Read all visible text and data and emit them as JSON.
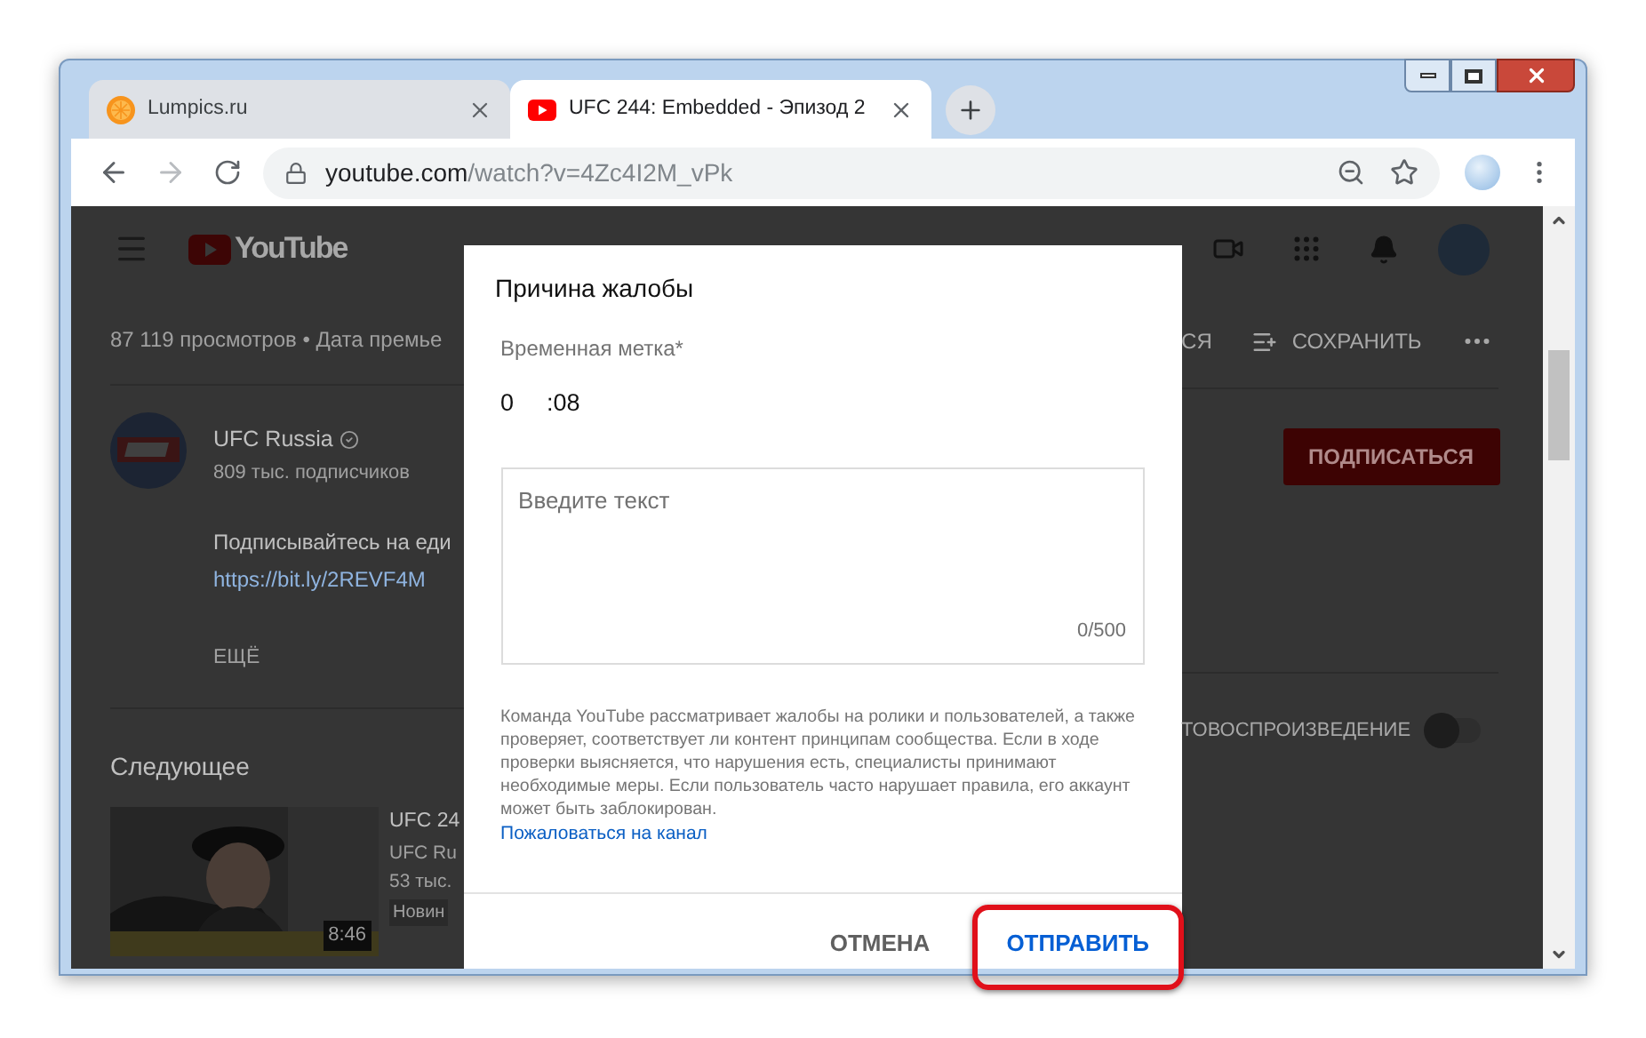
{
  "browser": {
    "tabs": [
      {
        "title": "Lumpics.ru",
        "kind": "fruit",
        "selected": false
      },
      {
        "title": "UFC 244: Embedded - Эпизод 2",
        "kind": "video",
        "selected": true
      }
    ],
    "address": {
      "host": "youtube.com",
      "path": "/watch?v=4Zc4I2M_vPk"
    }
  },
  "page": {
    "logo_text": "YouTube",
    "views_line": "87 119 просмотров • Дата премье",
    "partial_action": "СЯ",
    "save_label": "СОХРАНИТЬ",
    "channel": {
      "name": "UFC Russia",
      "subscribers": "809 тыс. подписчиков",
      "subscribe_button": "ПОДПИСАТЬСЯ",
      "description": "Подписывайтесь на еди",
      "link": "https://bit.ly/2REVF4M",
      "more": "ЕЩЁ"
    },
    "up_next": {
      "heading": "Следующее",
      "autoplay_label": "ТОВОСПРОИЗВЕДЕНИЕ",
      "autoplay_on": false,
      "items": [
        {
          "title": "UFC 24",
          "channel": "UFC Ru",
          "views": "53 тыс.",
          "badge": "Новин",
          "duration": "8:46"
        }
      ]
    }
  },
  "dialog": {
    "title": "Причина жалобы",
    "timestamp_label": "Временная метка*",
    "minutes": "0",
    "seconds": ":08",
    "textarea": {
      "placeholder": "Введите текст",
      "counter": "0/500"
    },
    "notice": "Команда YouTube рассматривает жалобы на ролики и пользователей, а также проверяет, соответствует ли контент принципам сообщества. Если в ходе проверки выясняется, что нарушения есть, специалисты принимают необходимые меры. Если пользователь часто нарушает правила, его аккаунт может быть заблокирован.",
    "report_channel_link": "Пожаловаться на канал",
    "buttons": [
      {
        "label": "ОТМЕНА",
        "kind": "cancel",
        "highlighted": false
      },
      {
        "label": "ОТПРАВИТЬ",
        "kind": "submit",
        "highlighted": true
      }
    ]
  }
}
